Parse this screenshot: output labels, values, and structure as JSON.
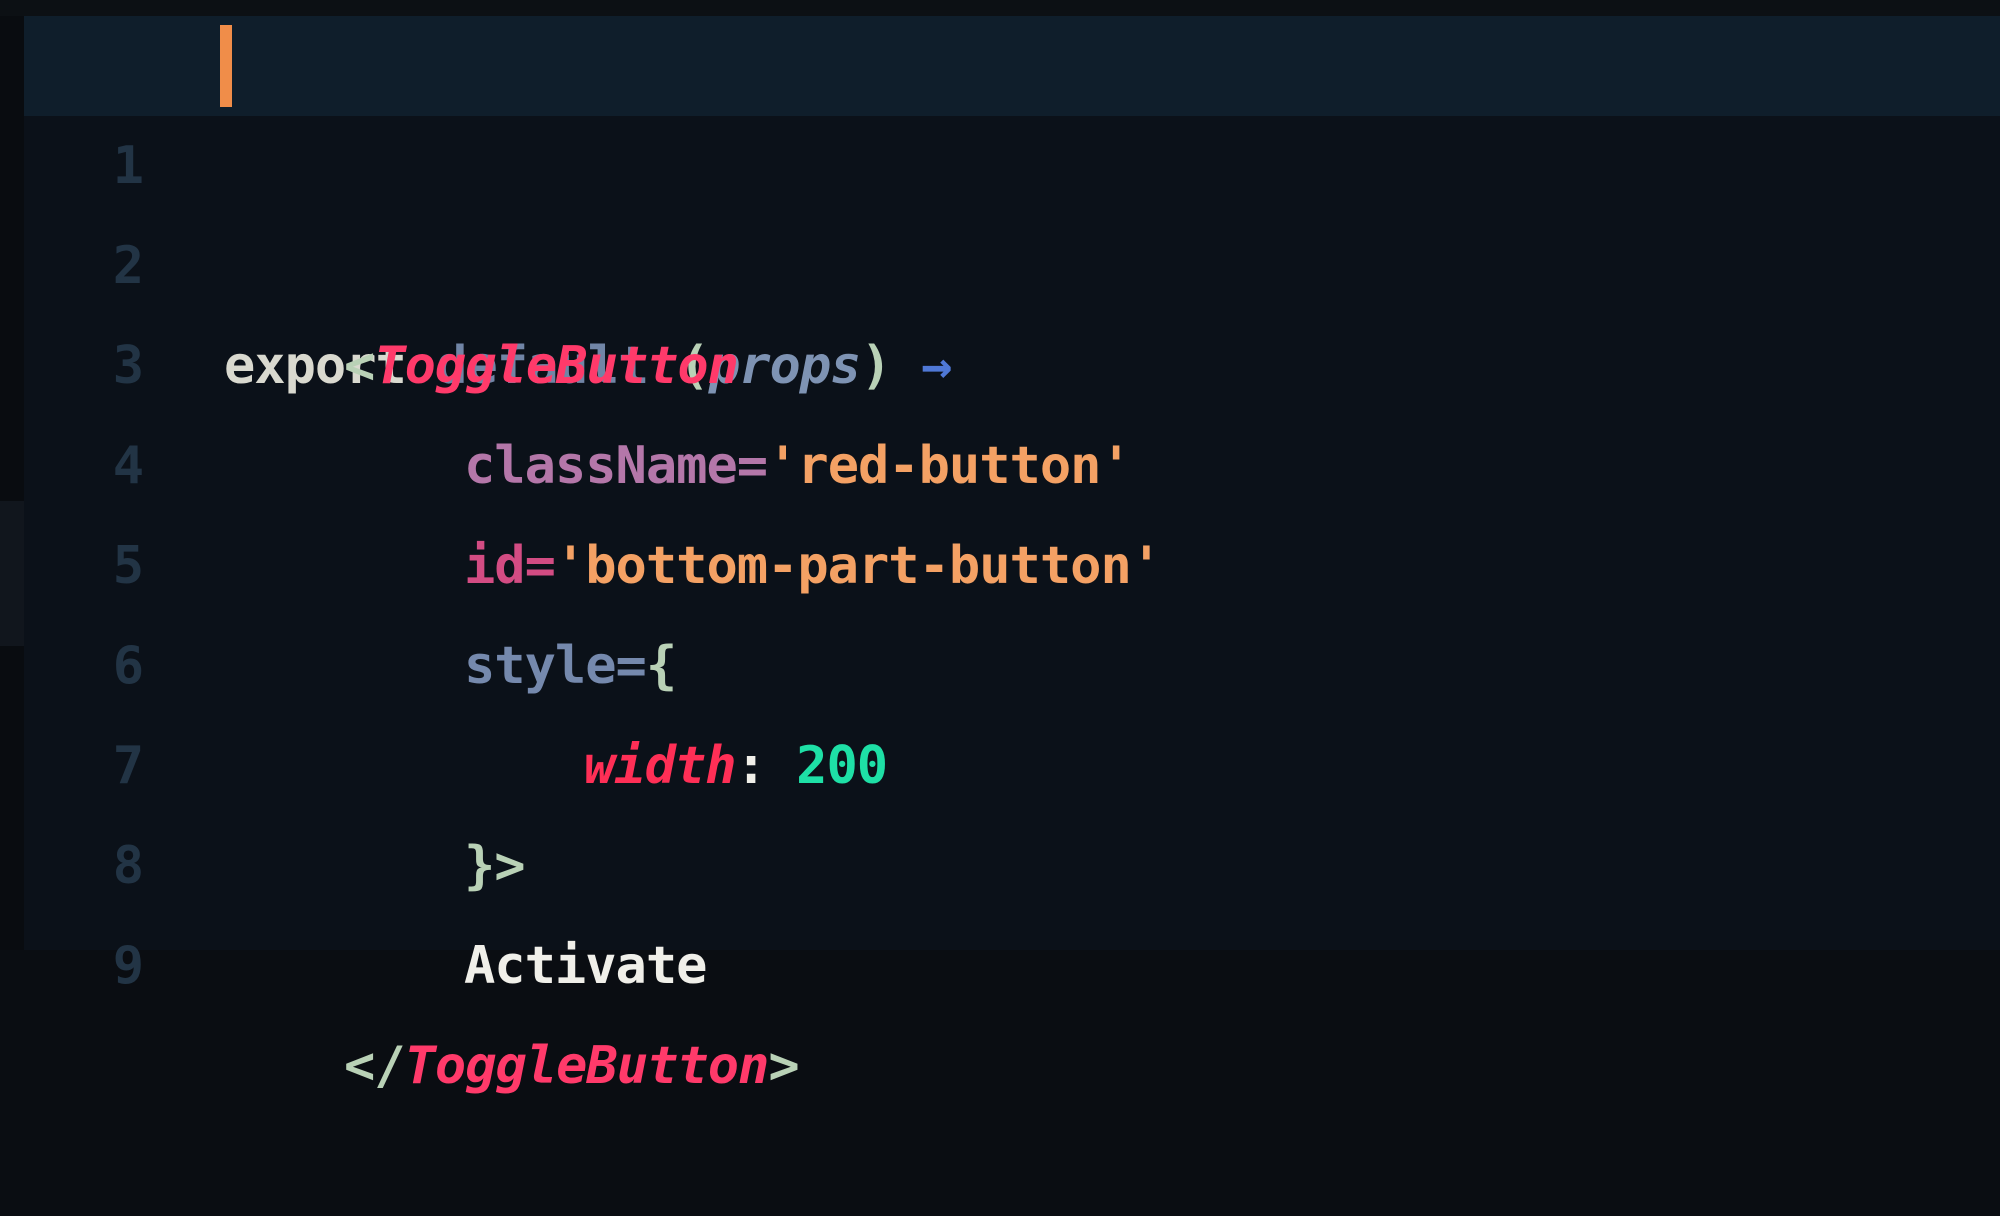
{
  "editor": {
    "line_numbers": [
      "1",
      "2",
      "3",
      "4",
      "5",
      "6",
      "7",
      "8",
      "9"
    ],
    "lines": {
      "l1": {
        "kw_export": "export",
        "kw_default": "default",
        "paren_open": "(",
        "param": "props",
        "paren_close": ")",
        "arrow": "→"
      },
      "l2": {
        "lt": "<",
        "tag": "ToggleButton"
      },
      "l3": {
        "attr": "className=",
        "value": "'red-button'"
      },
      "l4": {
        "attr": "id=",
        "value": "'bottom-part-button'"
      },
      "l5": {
        "attr": "style=",
        "brace": "{"
      },
      "l6": {
        "prop": "width",
        "colon": ":",
        "num": "200"
      },
      "l7": {
        "close": "}>"
      },
      "l8": {
        "text": "Activate"
      },
      "l9": {
        "lt": "</",
        "tag": "ToggleButton",
        "gt": ">"
      }
    },
    "colors": {
      "background": "#0b1119",
      "active_line": "#0f1e2b",
      "cursor": "#f08d49",
      "tag": "#ff3a6a",
      "string": "#f4a164",
      "number": "#1ee0a6"
    }
  }
}
